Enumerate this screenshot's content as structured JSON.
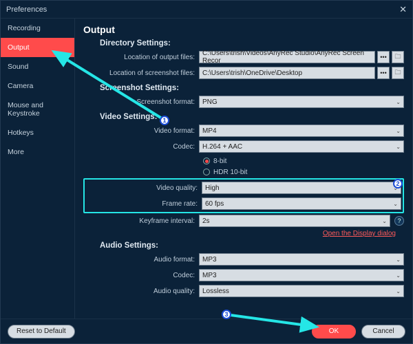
{
  "title": "Preferences",
  "sidebar": {
    "items": [
      {
        "label": "Recording"
      },
      {
        "label": "Output"
      },
      {
        "label": "Sound"
      },
      {
        "label": "Camera"
      },
      {
        "label": "Mouse and Keystroke"
      },
      {
        "label": "Hotkeys"
      },
      {
        "label": "More"
      }
    ],
    "activeIndex": 1
  },
  "page": {
    "heading": "Output",
    "directory": {
      "title": "Directory Settings:",
      "outputLabel": "Location of output files:",
      "outputValue": "C:\\Users\\trish\\Videos\\AnyRec Studio\\AnyRec Screen Recor",
      "screenshotLabel": "Location of screenshot files:",
      "screenshotValue": "C:\\Users\\trish\\OneDrive\\Desktop"
    },
    "screenshot": {
      "title": "Screenshot Settings:",
      "formatLabel": "Screenshot format:",
      "formatValue": "PNG"
    },
    "video": {
      "title": "Video Settings:",
      "formatLabel": "Video format:",
      "formatValue": "MP4",
      "codecLabel": "Codec:",
      "codecValue": "H.264 + AAC",
      "bitdepth": {
        "opt1": "8-bit",
        "opt2": "HDR 10-bit",
        "selected": 0
      },
      "qualityLabel": "Video quality:",
      "qualityValue": "High",
      "framerateLabel": "Frame rate:",
      "framerateValue": "60 fps",
      "keyframeLabel": "Keyframe interval:",
      "keyframeValue": "2s",
      "link": "Open the Display dialog"
    },
    "audio": {
      "title": "Audio Settings:",
      "formatLabel": "Audio format:",
      "formatValue": "MP3",
      "codecLabel": "Codec:",
      "codecValue": "MP3",
      "qualityLabel": "Audio quality:",
      "qualityValue": "Lossless"
    }
  },
  "footer": {
    "reset": "Reset to Default",
    "ok": "OK",
    "cancel": "Cancel"
  },
  "icons": {
    "dots": "•••",
    "folder": "🗀",
    "caret": "⌄",
    "help": "?"
  },
  "markers": {
    "m1": "1",
    "m2": "2",
    "m3": "3"
  }
}
